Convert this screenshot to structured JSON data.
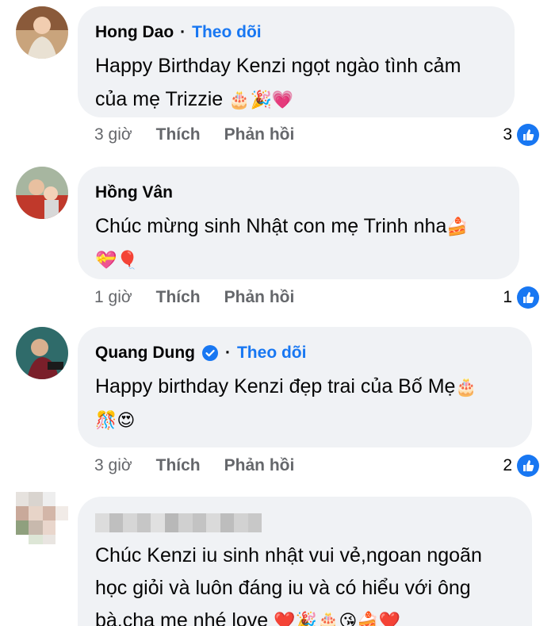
{
  "labels": {
    "like": "Thích",
    "reply": "Phản hồi",
    "follow": "Theo dõi",
    "dot": "·"
  },
  "comments": [
    {
      "name": "Hong Dao",
      "line1": "Happy Birthday Kenzi ngọt ngào tình cảm",
      "line2": "của mẹ Trizzie",
      "emojis": "🎂🎉💗",
      "time": "3 giờ",
      "reactions": "3"
    },
    {
      "name": "Hồng Vân",
      "line1": "Chúc mừng sinh Nhật con mẹ Trinh nha",
      "emojis_inline": "🍰",
      "emojis": "💝🎈",
      "time": "1 giờ",
      "reactions": "1"
    },
    {
      "name": "Quang Dung",
      "line1": "Happy birthday Kenzi đẹp trai của Bố Mẹ",
      "emojis_inline": "🎂",
      "emojis": "🎊😍",
      "time": "3 giờ",
      "reactions": "2"
    },
    {
      "name": "",
      "line1": "Chúc Kenzi iu sinh nhật vui vẻ,ngoan ngoãn",
      "line2": "học giỏi và luôn đáng iu và có hiểu với ông",
      "line3": "bà,cha mẹ nhé love",
      "emojis_inline": "❤️🎉🎂😘🍰❤️"
    }
  ],
  "colors": {
    "link_blue": "#1877f2",
    "bubble_bg": "#f0f2f5",
    "meta_gray": "#65676b"
  },
  "icons": [
    "like-thumb-icon",
    "verified-badge-icon"
  ]
}
